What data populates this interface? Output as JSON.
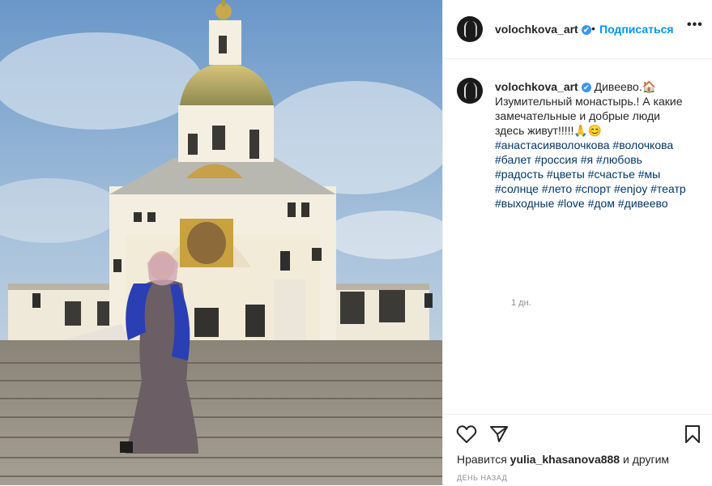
{
  "post": {
    "photo_alt": "",
    "username": "volochkova_art",
    "verified_mark": "✔",
    "separator": "•",
    "follow_label": "Подписаться",
    "more_label": "•••",
    "caption_lines": [
      "Дивеево.🏠",
      "Изумительный монастырь.! А какие",
      "замечательные и добрые люди",
      "здесь живут!!!!!🙏😊"
    ],
    "hashtag_lines": [
      "#анастасияволочкова #волочкова",
      "#балет #россия #я #любовь",
      "#радость #цветы #счастье #мы",
      "#солнце #лето #спорт #enjoy #театр",
      "#выходные #love #дом #дивеево"
    ],
    "caption_time": "1 дн.",
    "likes_prefix": "Нравится",
    "likes_user": "yulia_khasanova888",
    "likes_suffix": "и другим",
    "posted_label": "ДЕНЬ НАЗАД"
  },
  "icons": {
    "like": "heart-icon",
    "share": "share-icon",
    "save": "bookmark-icon",
    "more": "more-options-icon"
  },
  "colors": {
    "accent": "#0095f6",
    "verified": "#3897f0",
    "hashtag": "#00376b",
    "muted": "#8e8e8e"
  }
}
